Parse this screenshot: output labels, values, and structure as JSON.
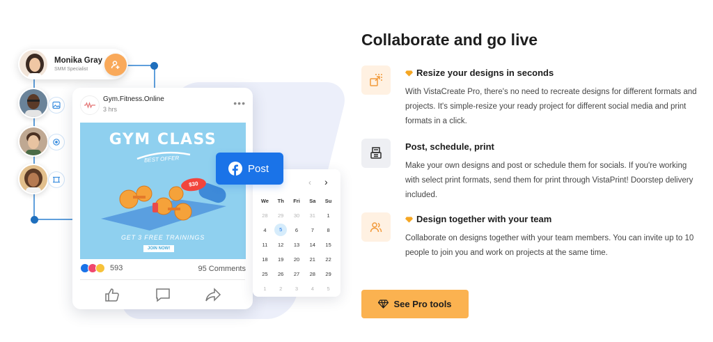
{
  "profile": {
    "name": "Monika Gray",
    "role": "SMM Specialist"
  },
  "post": {
    "account": "Gym.Fitness.Online",
    "time": "3 hrs",
    "image": {
      "title": "GYM CLASS",
      "subtitle": "BEST OFFER",
      "price": "$30",
      "free": "GET 3 FREE TRAININGS",
      "join": "JOIN NOW!"
    },
    "reactions_count": "593",
    "comments": "95 Comments"
  },
  "post_button": {
    "label": "Post"
  },
  "calendar": {
    "weekdays": [
      "We",
      "Th",
      "Fri",
      "Sa",
      "Su"
    ],
    "rows": [
      [
        {
          "d": "28",
          "m": true
        },
        {
          "d": "29",
          "m": true
        },
        {
          "d": "30",
          "m": true
        },
        {
          "d": "31",
          "m": true
        },
        {
          "d": "1"
        }
      ],
      [
        {
          "d": "4"
        },
        {
          "d": "5",
          "sel": true
        },
        {
          "d": "6"
        },
        {
          "d": "7"
        },
        {
          "d": "8"
        }
      ],
      [
        {
          "d": "11"
        },
        {
          "d": "12"
        },
        {
          "d": "13"
        },
        {
          "d": "14"
        },
        {
          "d": "15"
        }
      ],
      [
        {
          "d": "18"
        },
        {
          "d": "19"
        },
        {
          "d": "20"
        },
        {
          "d": "21"
        },
        {
          "d": "22"
        }
      ],
      [
        {
          "d": "25"
        },
        {
          "d": "26"
        },
        {
          "d": "27"
        },
        {
          "d": "28"
        },
        {
          "d": "29"
        }
      ],
      [
        {
          "d": "1",
          "m": true
        },
        {
          "d": "2",
          "m": true
        },
        {
          "d": "3",
          "m": true
        },
        {
          "d": "4",
          "m": true
        },
        {
          "d": "5",
          "m": true
        }
      ]
    ]
  },
  "section": {
    "heading": "Collaborate and go live",
    "features": [
      {
        "title": "Resize your designs in seconds",
        "pro": true,
        "icon": "resize-icon",
        "description": "With VistaCreate Pro, there's no need to recreate designs for different formats and projects. It's simple-resize your ready project for different social media and print formats in a click."
      },
      {
        "title": "Post, schedule, print",
        "pro": false,
        "icon": "printer-icon",
        "description": "Make your own designs and post or schedule them for socials. If you're working with select print formats, send them for print through VistaPrint! Doorstep delivery included."
      },
      {
        "title": "Design together with your team",
        "pro": true,
        "icon": "team-icon",
        "description": "Collaborate on designs together with your team members. You can invite up to 10 people to join you and work on projects at the same time."
      }
    ],
    "cta": "See Pro tools"
  },
  "colors": {
    "accent_orange": "#fbb250",
    "facebook_blue": "#1a73e8",
    "pro_gem": "#f5a623"
  }
}
